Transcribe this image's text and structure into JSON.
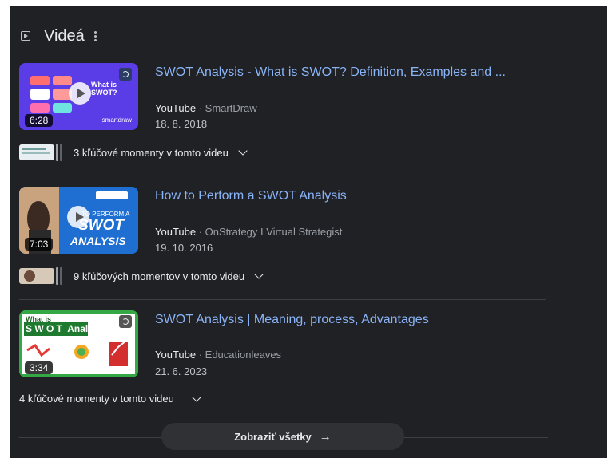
{
  "section": {
    "icon": "video-play-icon",
    "title": "Videá",
    "menu_icon": "kebab-menu-icon"
  },
  "videos": [
    {
      "title": "SWOT Analysis - What is SWOT? Definition, Examples and ...",
      "source": "YouTube",
      "separator": " · ",
      "channel": "SmartDraw",
      "date": "18. 8. 2018",
      "duration": "6:28",
      "thumb_text": "What is SWOT?",
      "thumb_brand": "smartdraw",
      "moments": "3 kľúčové momenty v tomto videu"
    },
    {
      "title": "How to Perform a SWOT Analysis",
      "source": "YouTube",
      "separator": " · ",
      "channel": "OnStrategy I Virtual Strategist",
      "date": "19. 10. 2016",
      "duration": "7:03",
      "thumb_text_small": "TO PERFORM A",
      "thumb_text_big1": "SWOT",
      "thumb_text_big2": "ANALYSIS",
      "moments": "9 kľúčových momentov v tomto videu"
    },
    {
      "title": "SWOT Analysis | Meaning, process, Advantages",
      "source": "YouTube",
      "separator": " · ",
      "channel": "Educationleaves",
      "date": "21. 6. 2023",
      "duration": "3:34",
      "thumb_text_small": "What is",
      "thumb_text_big": "S W O T  Analysis",
      "moments": "4 kľúčové momenty v tomto videu"
    }
  ],
  "show_all": "Zobraziť všetky",
  "colors": {
    "background": "#202124",
    "link": "#8ab4f8",
    "text": "#e8eaed",
    "muted": "#9aa0a6"
  }
}
